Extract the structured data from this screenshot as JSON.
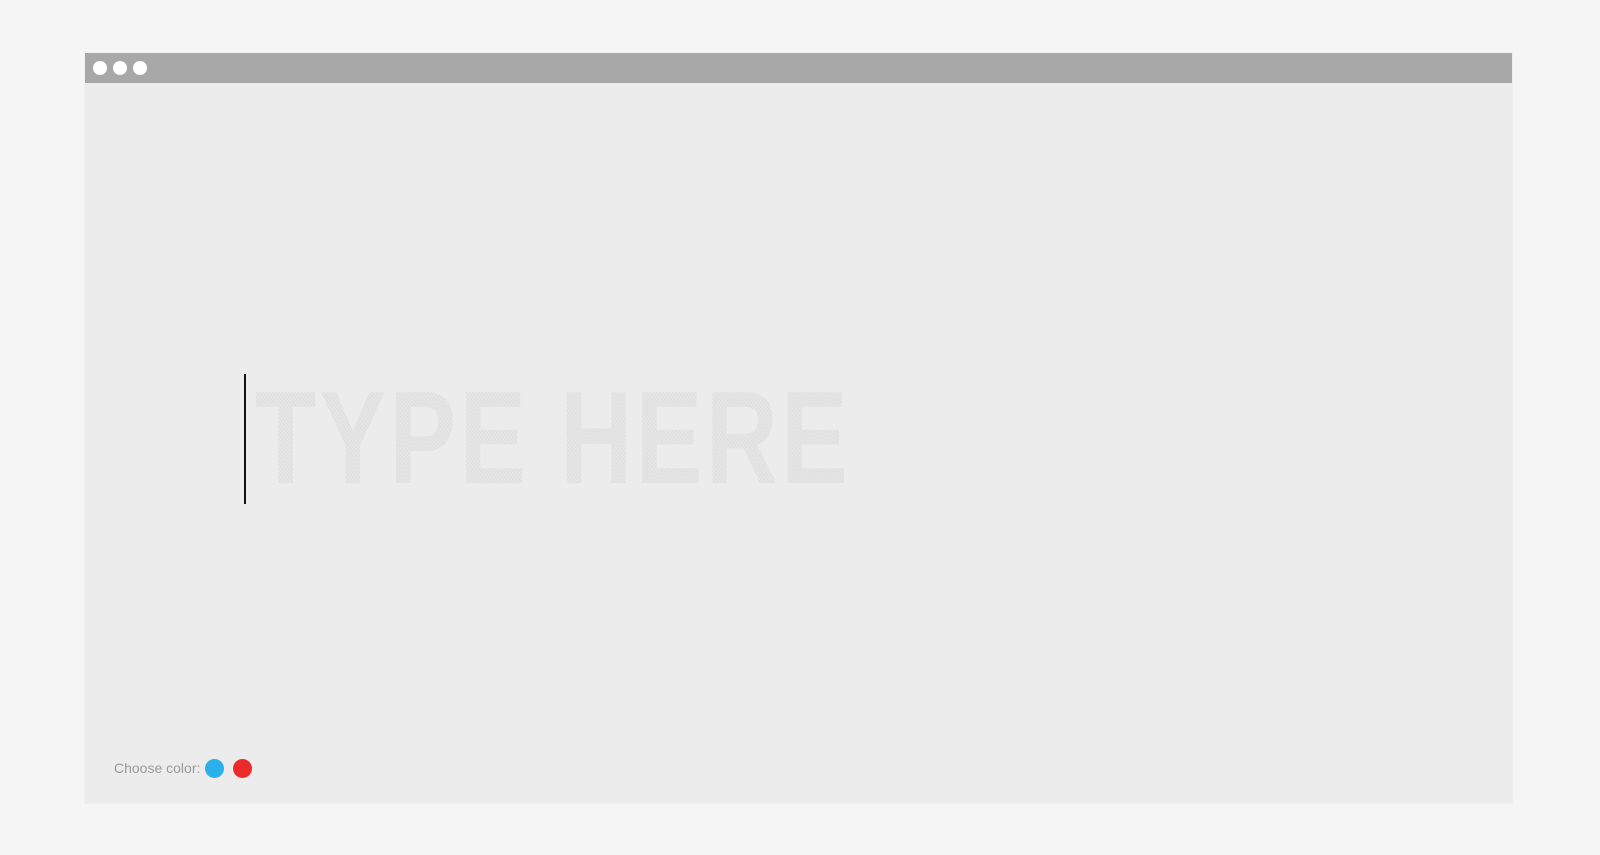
{
  "editor": {
    "placeholder": "TYPE HERE"
  },
  "color_picker": {
    "label": "Choose color:",
    "swatches": [
      {
        "name": "blue",
        "color": "#2cb0ea"
      },
      {
        "name": "red",
        "color": "#ec2a2a"
      }
    ]
  },
  "window": {
    "controls": [
      "window-dot-icon",
      "window-dot-icon",
      "window-dot-icon"
    ]
  }
}
